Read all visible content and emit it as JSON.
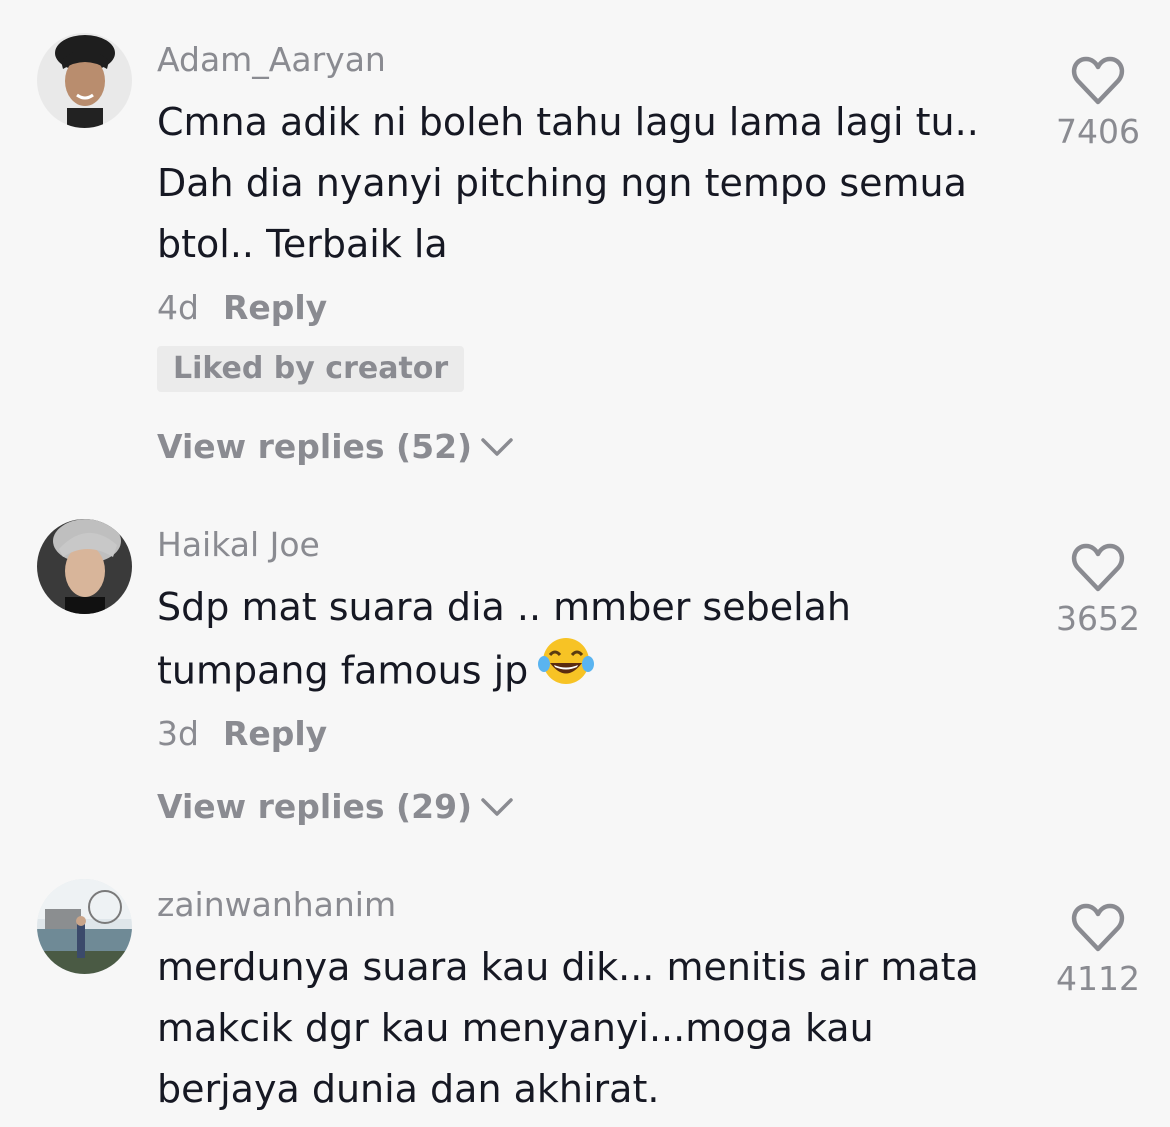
{
  "comments": [
    {
      "username": "Adam_Aaryan",
      "avatar_icon": "avatar-young-man-icon",
      "text": "Cmna adik ni boleh tahu lagu lama lagi tu..\nDah dia nyanyi pitching ngn tempo semua\nbtol.. Terbaik la",
      "age": "4d",
      "reply_label": "Reply",
      "badge": "Liked by creator",
      "view_replies": "View replies (52)",
      "likes": "7406"
    },
    {
      "username": "Haikal Joe",
      "avatar_icon": "avatar-young-man-icon",
      "text": "Sdp mat suara dia .. mmber sebelah\ntumpang famous jp",
      "emoji": "face-with-tears-of-joy-icon",
      "age": "3d",
      "reply_label": "Reply",
      "view_replies": "View replies (29)",
      "likes": "3652"
    },
    {
      "username": "zainwanhanim",
      "avatar_icon": "avatar-photo-waterfront-icon",
      "text": "merdunya suara kau dik... menitis air mata\nmakcik dgr kau menyanyi...moga kau\nberjaya dunia dan akhirat.",
      "likes": "4112"
    }
  ],
  "colors": {
    "background": "#f7f7f7",
    "text_primary": "#161823",
    "text_secondary": "#8a8b91",
    "badge_bg": "#ebebeb"
  }
}
